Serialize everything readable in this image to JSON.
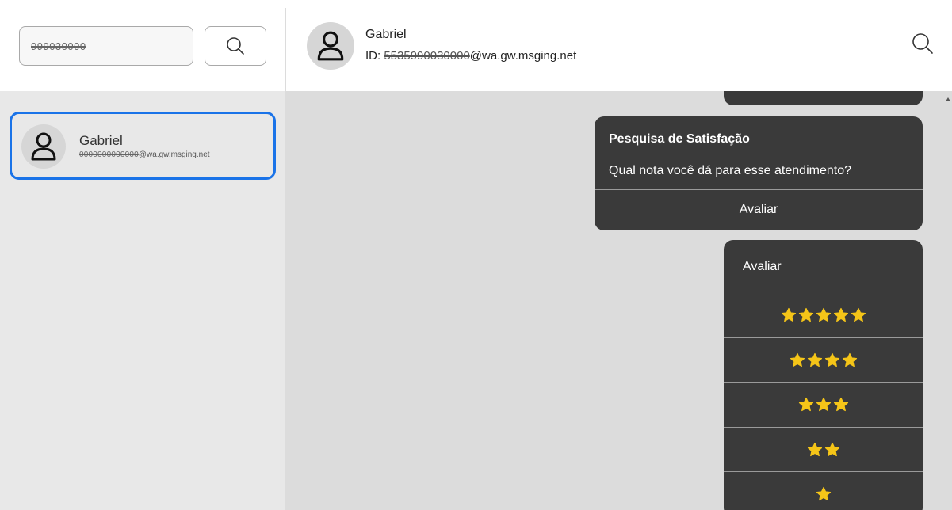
{
  "sidebar": {
    "search": {
      "value": "999030000"
    },
    "contacts": [
      {
        "name": "Gabriel",
        "id_masked": "0000000000000",
        "id_domain": "@wa.gw.msging.net"
      }
    ]
  },
  "header": {
    "contact_name": "Gabriel",
    "id_prefix": "ID: ",
    "id_masked": "5535990030000",
    "id_domain": "@wa.gw.msging.net"
  },
  "chat": {
    "survey": {
      "title": "Pesquisa de Satisfação",
      "question": "Qual nota você dá para esse atendimento?",
      "button_label": "Avaliar"
    },
    "rating": {
      "title": "Avaliar",
      "options": [
        5,
        4,
        3,
        2,
        1
      ]
    }
  },
  "colors": {
    "accent": "#1a73e8",
    "bubble": "#3a3a3a",
    "star": "#f5c518"
  },
  "icons": [
    "search-icon",
    "user-icon",
    "star-icon"
  ]
}
